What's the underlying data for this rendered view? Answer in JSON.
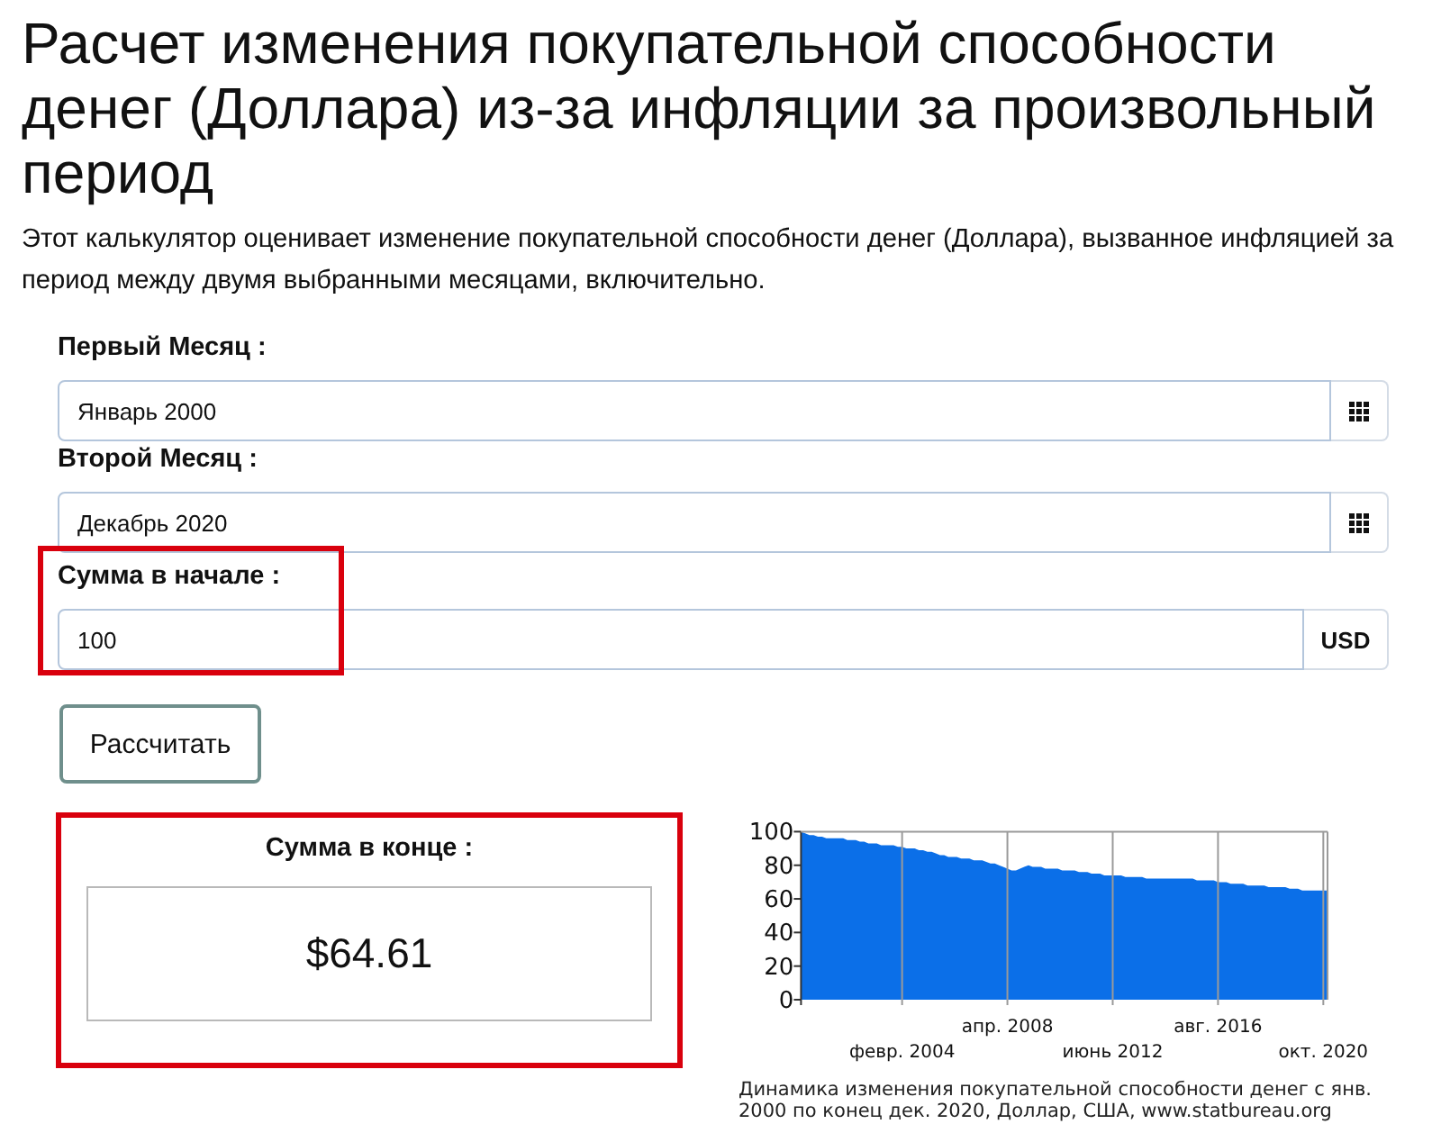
{
  "title": "Расчет изменения покупательной способности денег (Доллара) из-за инфляции за произвольный период",
  "description": "Этот калькулятор оценивает изменение покупательной способности денег (Доллара), вызванное инфляцией за период между двумя выбранными месяцами, включительно.",
  "form": {
    "fields": [
      {
        "kind": "month",
        "label": "Первый Месяц :",
        "value": "Январь 2000",
        "highlighted": false
      },
      {
        "kind": "month",
        "label": "Второй Месяц :",
        "value": "Декабрь 2020",
        "highlighted": false
      },
      {
        "kind": "amount",
        "label": "Сумма в начале :",
        "value": "100",
        "addon": "USD",
        "highlighted": true
      }
    ],
    "calculate_button": "Рассчитать"
  },
  "result": {
    "label": "Сумма в конце :",
    "value": "$64.61",
    "highlighted": true
  },
  "chart": {
    "chart_data": {
      "type": "area",
      "title": "Динамика изменения покупательной способности денег с янв. 2000 по конец дек. 2020, Доллар, США, www.statbureau.org",
      "categories": [
        null,
        null,
        null,
        null,
        null,
        null,
        null,
        null,
        null,
        null,
        null,
        null,
        null,
        null,
        null,
        null,
        null,
        null,
        null,
        null,
        null,
        null,
        null,
        null,
        "февр. 2004",
        null,
        null,
        null,
        null,
        null,
        null,
        null,
        null,
        null,
        null,
        null,
        null,
        null,
        null,
        null,
        null,
        null,
        null,
        null,
        null,
        null,
        null,
        null,
        null,
        "апр. 2008",
        null,
        null,
        null,
        null,
        null,
        null,
        null,
        null,
        null,
        null,
        null,
        null,
        null,
        null,
        null,
        null,
        null,
        null,
        null,
        null,
        null,
        null,
        null,
        null,
        "июнь 2012",
        null,
        null,
        null,
        null,
        null,
        null,
        null,
        null,
        null,
        null,
        null,
        null,
        null,
        null,
        null,
        null,
        null,
        null,
        null,
        null,
        null,
        null,
        null,
        null,
        "авг. 2016",
        null,
        null,
        null,
        null,
        null,
        null,
        null,
        null,
        null,
        null,
        null,
        null,
        null,
        null,
        null,
        null,
        null,
        null,
        null,
        null,
        null,
        null,
        null,
        null,
        "окт. 2020",
        null
      ],
      "values": [
        100,
        99,
        98,
        98,
        97,
        97,
        96,
        96,
        96,
        96,
        96,
        95,
        95,
        95,
        94,
        94,
        93,
        93,
        93,
        92,
        92,
        92,
        92,
        91,
        91,
        90,
        90,
        90,
        89,
        89,
        88,
        88,
        87,
        86,
        86,
        85,
        85,
        85,
        84,
        84,
        84,
        83,
        83,
        83,
        82,
        81,
        81,
        80,
        79,
        78,
        77,
        77,
        78,
        79,
        80,
        79,
        79,
        79,
        78,
        78,
        78,
        78,
        77,
        77,
        77,
        77,
        76,
        76,
        76,
        75,
        75,
        75,
        74,
        74,
        74,
        74,
        74,
        73,
        73,
        73,
        73,
        73,
        72,
        72,
        72,
        72,
        72,
        72,
        72,
        72,
        72,
        72,
        72,
        72,
        71,
        71,
        71,
        71,
        71,
        70,
        70,
        70,
        69,
        69,
        69,
        69,
        68,
        68,
        68,
        68,
        68,
        67,
        67,
        67,
        67,
        67,
        66,
        66,
        66,
        65,
        65,
        65,
        65,
        65,
        65,
        65
      ],
      "ylim": [
        0,
        100
      ],
      "yticks": [
        0,
        20,
        40,
        60,
        80,
        100
      ]
    }
  }
}
